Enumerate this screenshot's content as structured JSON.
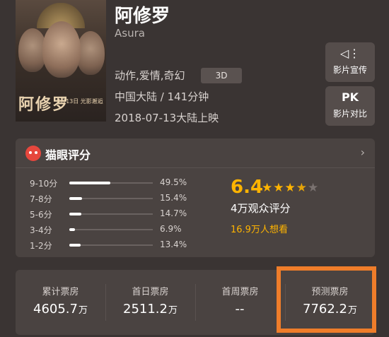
{
  "movie": {
    "title": "阿修罗",
    "subtitle": "Asura",
    "genres": "动作,爱情,奇幻",
    "format_badge": "3D",
    "origin_runtime": "中国大陆 / 141分钟",
    "release": "2018-07-13大陆上映",
    "poster": {
      "title_text": "阿修罗",
      "date_text": "7月13日 光影邂逅"
    }
  },
  "actions": [
    {
      "label": "影片宣传",
      "icon": "speaker-icon",
      "glyph": "◁⋮"
    },
    {
      "label": "影片对比",
      "icon": "pk-icon",
      "glyph": "PK"
    }
  ],
  "rating": {
    "header": "猫眼评分",
    "score": "6.4",
    "stars_on": 3,
    "stars_half": 1,
    "stars_total": 5,
    "raters": "4万观众评分",
    "wants": "16.9万人想看",
    "distribution": [
      {
        "label": "9-10分",
        "pct": "49.5%",
        "value": 49.5
      },
      {
        "label": "7-8分",
        "pct": "15.4%",
        "value": 15.4
      },
      {
        "label": "5-6分",
        "pct": "14.7%",
        "value": 14.7
      },
      {
        "label": "3-4分",
        "pct": "6.9%",
        "value": 6.9
      },
      {
        "label": "1-2分",
        "pct": "13.4%",
        "value": 13.4
      }
    ]
  },
  "boxoffice": [
    {
      "label": "累计票房",
      "value": "4605.7",
      "unit": "万"
    },
    {
      "label": "首日票房",
      "value": "2511.2",
      "unit": "万"
    },
    {
      "label": "首周票房",
      "value": "--",
      "unit": ""
    },
    {
      "label": "预测票房",
      "value": "7762.2",
      "unit": "万"
    }
  ],
  "colors": {
    "accent": "#ffb400",
    "highlight": "#ef7d2a",
    "cat": "#e6473d"
  }
}
